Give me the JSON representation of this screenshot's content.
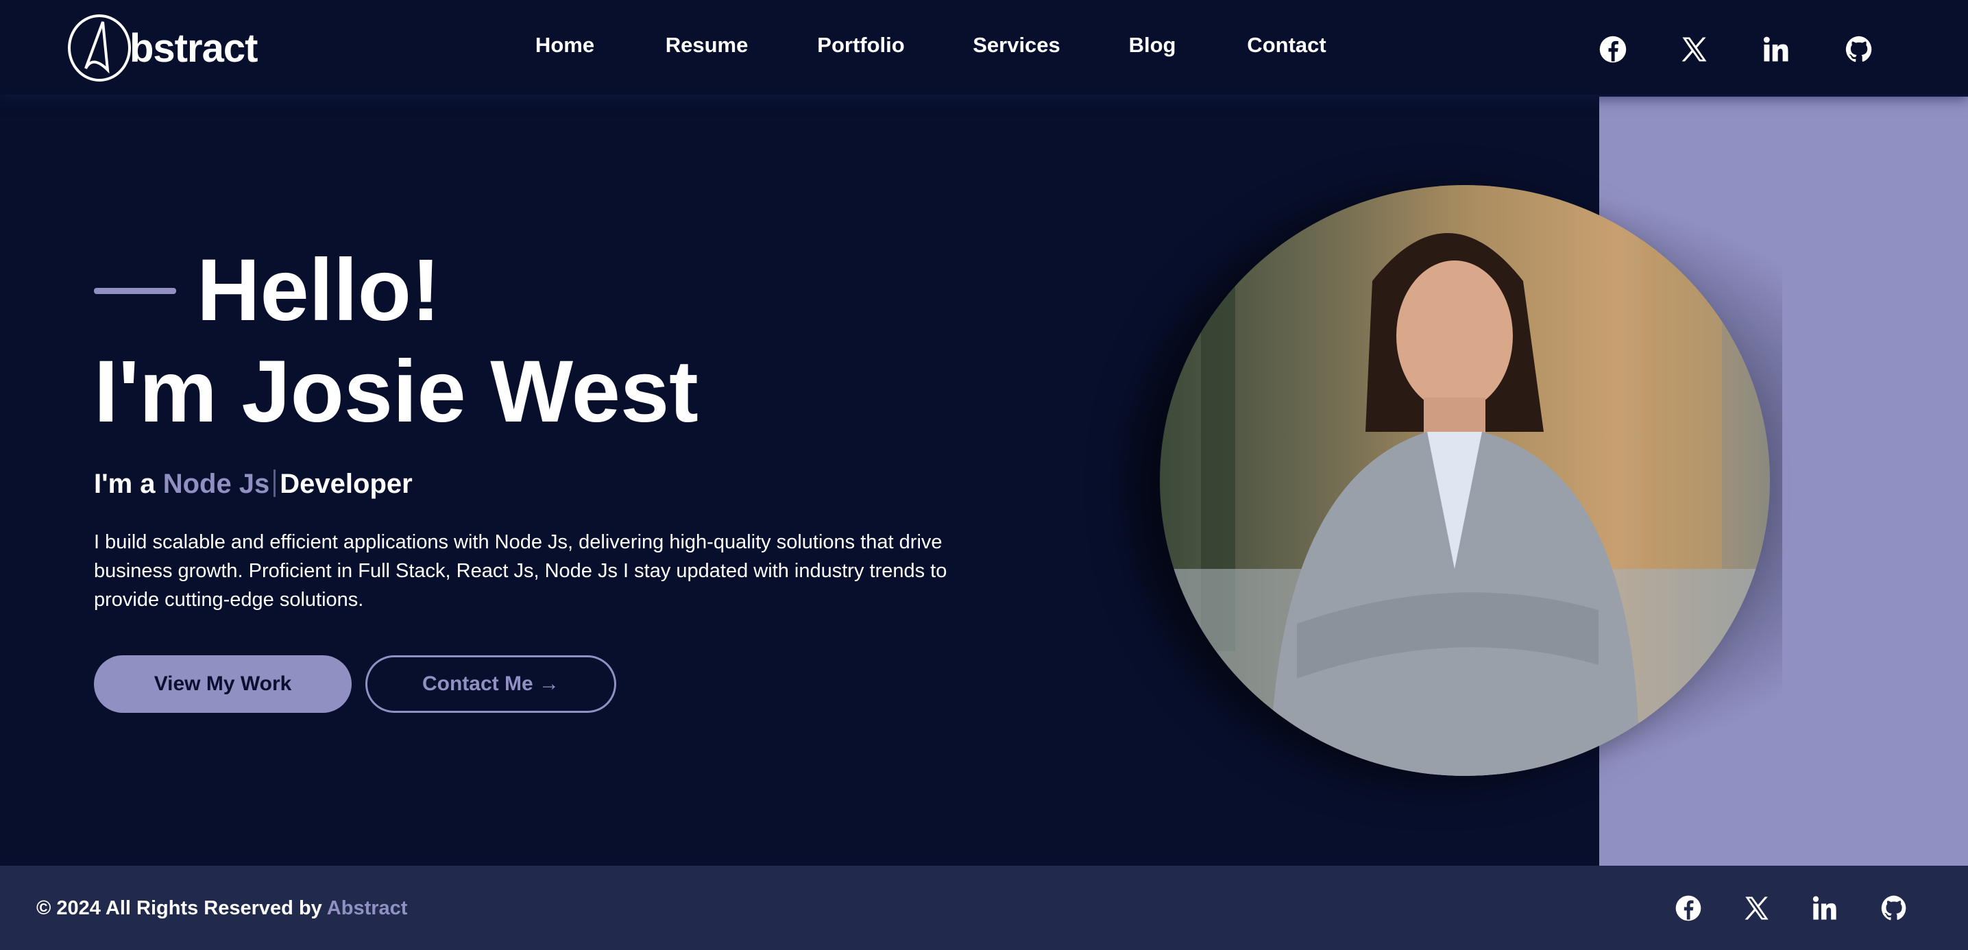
{
  "header": {
    "logo_text": "bstract",
    "logo_letter": "A",
    "nav": [
      "Home",
      "Resume",
      "Portfolio",
      "Services",
      "Blog",
      "Contact"
    ],
    "social": [
      "facebook-icon",
      "x-icon",
      "linkedin-icon",
      "github-icon"
    ]
  },
  "hero": {
    "greeting": "Hello!",
    "name": "I'm Josie West",
    "role_prefix": "I'm a",
    "role_skill": "Node Js",
    "role_suffix": "Developer",
    "description": "I build scalable and efficient applications with Node Js, delivering high-quality solutions that drive business growth. Proficient in Full Stack, React Js, Node Js I stay updated with industry trends to provide cutting-edge solutions.",
    "primary_button": "View My Work",
    "secondary_button": "Contact Me →"
  },
  "footer": {
    "copyright": "© 2024 All Rights Reserved by",
    "brand": "Abstract"
  },
  "colors": {
    "background": "#080f2c",
    "accent": "#9190c3",
    "footer": "#212a4d"
  }
}
